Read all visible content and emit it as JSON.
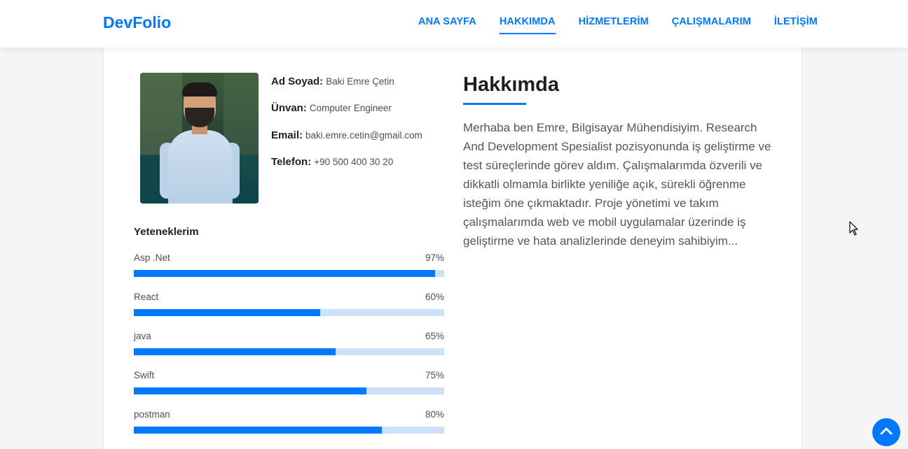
{
  "nav": {
    "brand": "DevFolio",
    "links": [
      {
        "label": "ANA SAYFA"
      },
      {
        "label": "HAKKIMDA"
      },
      {
        "label": "HİZMETLERİM"
      },
      {
        "label": "ÇALIŞMALARIM"
      },
      {
        "label": "İLETİŞİM"
      }
    ]
  },
  "profile": {
    "name_label": "Ad Soyad:",
    "name_value": "Baki Emre Çetin",
    "title_label": "Ünvan:",
    "title_value": "Computer Engineer",
    "email_label": "Email:",
    "email_value": "baki.emre.cetin@gmail.com",
    "phone_label": "Telefon:",
    "phone_value": "+90 500 400 30 20"
  },
  "skills": {
    "title": "Yeteneklerim",
    "items": [
      {
        "name": "Asp .Net",
        "percent_label": "97%",
        "percent": 97
      },
      {
        "name": "React",
        "percent_label": "60%",
        "percent": 60
      },
      {
        "name": "java",
        "percent_label": "65%",
        "percent": 65
      },
      {
        "name": "Swift",
        "percent_label": "75%",
        "percent": 75
      },
      {
        "name": "postman",
        "percent_label": "80%",
        "percent": 80
      }
    ]
  },
  "about": {
    "title": "Hakkımda",
    "text": "Merhaba ben Emre, Bilgisayar Mühendisiyim. Research And Development Spesialist pozisyonunda iş geliştirme ve test süreçlerinde görev aldım. Çalışmalarımda özverili ve dikkatli olmamla birlikte yeniliğe açık, sürekli öğrenme isteğim öne çıkmaktadır. Proje yönetimi ve takım çalışmalarımda web ve mobil uygulamalar üzerinde iş geliştirme ve hata analizlerinde deneyim sahibiyim..."
  },
  "colors": {
    "accent": "#0078ff",
    "track": "#cde1f8"
  },
  "icons": {
    "back_to_top": "chevron-up-icon",
    "cursor": "mouse-pointer-icon"
  }
}
